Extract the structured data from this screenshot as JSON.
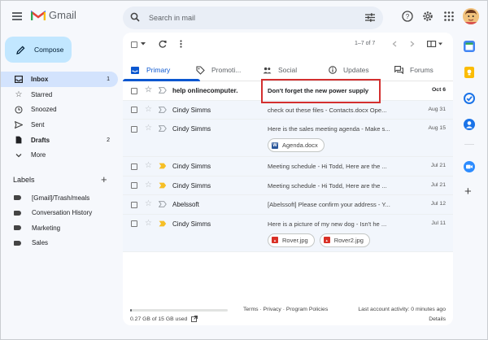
{
  "app": {
    "name": "Gmail"
  },
  "search": {
    "placeholder": "Search in mail"
  },
  "compose": {
    "label": "Compose"
  },
  "nav": [
    {
      "label": "Inbox",
      "count": "1",
      "icon": "inbox-icon"
    },
    {
      "label": "Starred",
      "count": "",
      "icon": "star-icon"
    },
    {
      "label": "Snoozed",
      "count": "",
      "icon": "clock-icon"
    },
    {
      "label": "Sent",
      "count": "",
      "icon": "send-icon"
    },
    {
      "label": "Drafts",
      "count": "2",
      "icon": "file-icon"
    },
    {
      "label": "More",
      "count": "",
      "icon": "chevron-down-icon"
    }
  ],
  "labels": {
    "heading": "Labels",
    "items": [
      "[Gmail]/Trash/meals",
      "Conversation History",
      "Marketing",
      "Sales"
    ]
  },
  "toolbar": {
    "pagination": "1–7 of 7"
  },
  "tabs": [
    {
      "label": "Primary",
      "icon": "inbox-icon"
    },
    {
      "label": "Promoti...",
      "icon": "tag-icon"
    },
    {
      "label": "Social",
      "icon": "people-icon"
    },
    {
      "label": "Updates",
      "icon": "info-icon"
    },
    {
      "label": "Forums",
      "icon": "chat-icon"
    }
  ],
  "emails": [
    {
      "sender": "help onlinecomputer.",
      "subject": "Don't forget the new power supply",
      "date": "Oct 6",
      "unread": true,
      "important": false,
      "attachments": []
    },
    {
      "sender": "Cindy Simms",
      "subject": "check out these files - Contacts.docx Ope...",
      "date": "Aug 31",
      "unread": false,
      "important": false,
      "attachments": []
    },
    {
      "sender": "Cindy Simms",
      "subject": "Here is the sales meeting agenda - Make s...",
      "date": "Aug 15",
      "unread": false,
      "important": false,
      "attachments": [
        {
          "name": "Agenda.docx",
          "type": "word"
        }
      ]
    },
    {
      "sender": "Cindy Simms",
      "subject": "Meeting schedule - Hi Todd, Here are the ...",
      "date": "Jul 21",
      "unread": false,
      "important": true,
      "attachments": []
    },
    {
      "sender": "Cindy Simms",
      "subject": "Meeting schedule - Hi Todd, Here are the ...",
      "date": "Jul 21",
      "unread": false,
      "important": true,
      "attachments": []
    },
    {
      "sender": "Abelssoft",
      "subject": "[Abelssoft] Please confirm your address - Y...",
      "date": "Jul 12",
      "unread": false,
      "important": false,
      "attachments": []
    },
    {
      "sender": "Cindy Simms",
      "subject": "Here is a picture of my new dog - Isn't he ...",
      "date": "Jul 11",
      "unread": false,
      "important": true,
      "attachments": [
        {
          "name": "Rover.jpg",
          "type": "image"
        },
        {
          "name": "Rover2.jpg",
          "type": "image"
        }
      ]
    }
  ],
  "footer": {
    "storage": "0.27 GB of 15 GB used",
    "storage_fraction": 0.018,
    "links": "Terms · Privacy · Program Policies",
    "activity": "Last account activity: 0 minutes ago",
    "details": "Details"
  },
  "colors": {
    "accent": "#0b57d0",
    "compose_bg": "#c2e7ff",
    "active_nav": "#d3e3fd",
    "important": "#f6bf26",
    "highlight_box": "#d32f2f"
  }
}
